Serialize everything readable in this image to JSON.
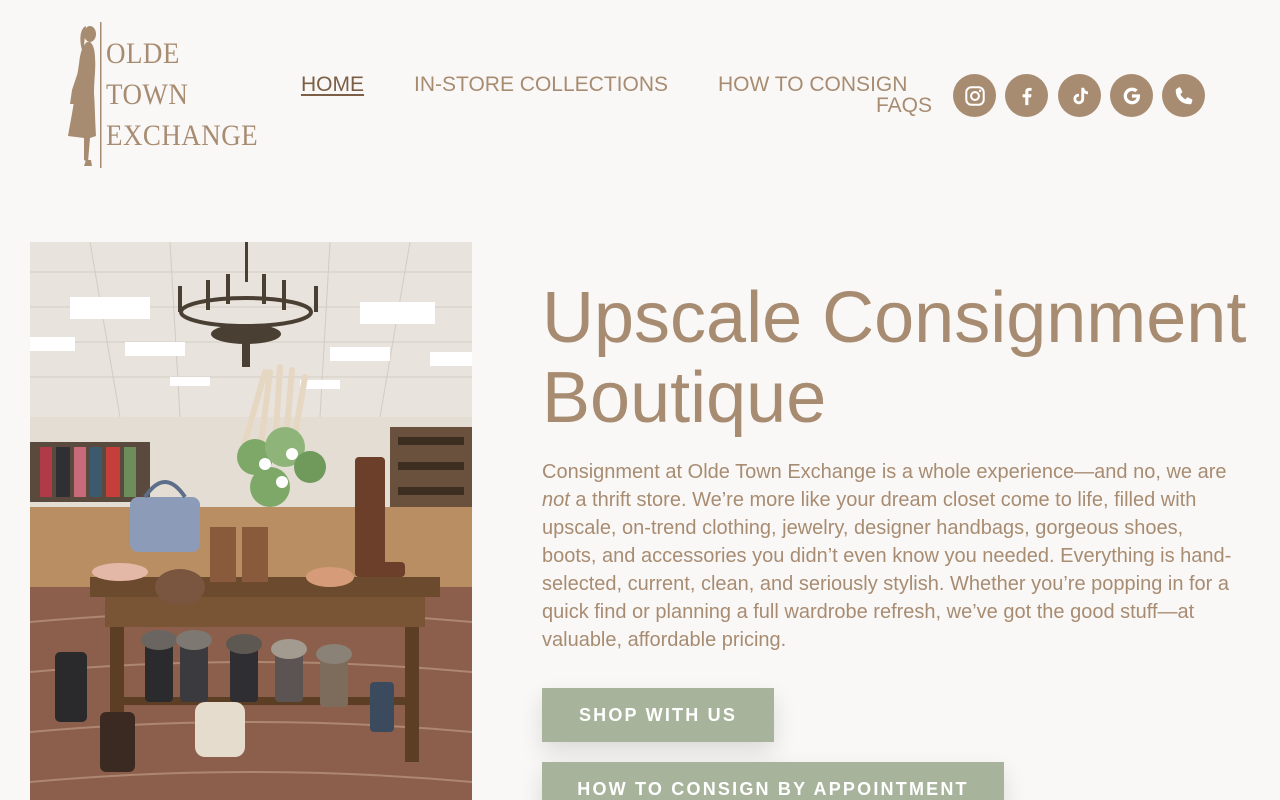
{
  "brand": {
    "logo_lines": [
      "OLDE",
      "TOWN",
      "EXCHANGE"
    ],
    "color": "#a88c72"
  },
  "nav": {
    "items": [
      {
        "label": "HOME",
        "active": true
      },
      {
        "label": "IN-STORE COLLECTIONS",
        "active": false
      },
      {
        "label": "HOW TO CONSIGN",
        "active": false
      },
      {
        "label": "FAQS",
        "active": false
      }
    ]
  },
  "social": [
    {
      "icon": "instagram-icon"
    },
    {
      "icon": "facebook-icon"
    },
    {
      "icon": "tiktok-icon"
    },
    {
      "icon": "google-icon"
    },
    {
      "icon": "phone-icon"
    }
  ],
  "hero": {
    "title": "Upscale Consignment Boutique",
    "body_pre": "Consignment at Olde Town Exchange is a whole experience—and no, we are ",
    "body_em": "not",
    "body_post": " a thrift store. We’re more like your dream closet come to life, filled with upscale, on-trend clothing, jewelry, designer handbags, gorgeous shoes, boots, and accessories you didn’t even know you needed. Everything is hand-selected, current, clean, and seriously stylish. Whether you’re popping in for a quick find or planning a full wardrobe refresh, we’ve got the good stuff—at valuable, affordable pricing.",
    "buttons": [
      "SHOP WITH US",
      "HOW TO CONSIGN BY APPOINTMENT"
    ],
    "button_color": "#a8b39c"
  }
}
